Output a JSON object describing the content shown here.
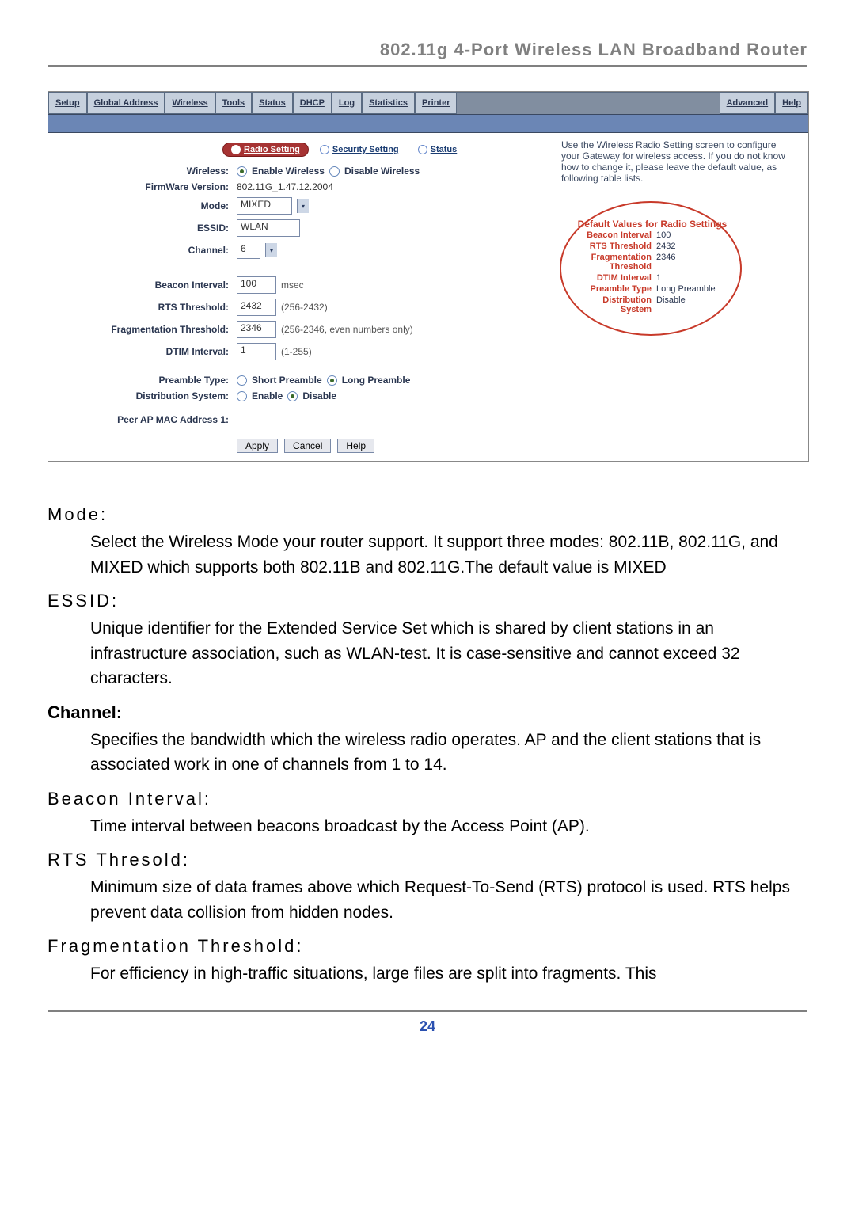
{
  "header": "802.11g 4-Port Wireless LAN Broadband Router",
  "nav": [
    "Setup",
    "Global Address",
    "Wireless",
    "Tools",
    "Status",
    "DHCP",
    "Log",
    "Statistics",
    "Printer"
  ],
  "nav_right": [
    "Advanced",
    "Help"
  ],
  "subtabs": {
    "radio": "Radio Setting",
    "security": "Security Setting",
    "status": "Status"
  },
  "form": {
    "wireless_label": "Wireless:",
    "wireless_opts": {
      "enable": "Enable Wireless",
      "disable": "Disable Wireless"
    },
    "fw_label": "FirmWare Version:",
    "fw": "802.11G_1.47.12.2004",
    "mode_label": "Mode:",
    "mode": "MIXED",
    "essid_label": "ESSID:",
    "essid": "WLAN",
    "channel_label": "Channel:",
    "channel": "6",
    "beacon_label": "Beacon Interval:",
    "beacon": "100",
    "beacon_hint": "msec",
    "rts_label": "RTS Threshold:",
    "rts": "2432",
    "rts_hint": "(256-2432)",
    "frag_label": "Fragmentation Threshold:",
    "frag": "2346",
    "frag_hint": "(256-2346, even numbers only)",
    "dtim_label": "DTIM Interval:",
    "dtim": "1",
    "dtim_hint": "(1-255)",
    "preamble_label": "Preamble Type:",
    "preamble_opts": {
      "short": "Short Preamble",
      "long": "Long Preamble"
    },
    "dist_label": "Distribution System:",
    "dist_opts": {
      "en": "Enable",
      "dis": "Disable"
    },
    "peer_label": "Peer AP MAC Address 1:",
    "btn_apply": "Apply",
    "btn_cancel": "Cancel",
    "btn_help": "Help"
  },
  "help_text": "Use the Wireless Radio Setting screen to configure your Gateway for wireless access. If you do not know how to change it, please leave the default value, as following table lists.",
  "defaults": {
    "title": "Default Values for Radio Settings",
    "rows": [
      {
        "l": "Beacon Interval",
        "v": "100"
      },
      {
        "l": "RTS Threshold",
        "v": "2432"
      },
      {
        "l": "Fragmentation Threshold",
        "v": "2346"
      },
      {
        "l": "DTIM Interval",
        "v": "1"
      },
      {
        "l": "Preamble Type",
        "v": "Long Preamble"
      },
      {
        "l": "Distribution System",
        "v": "Disable"
      }
    ]
  },
  "doc": {
    "mode_h": "Mode:",
    "mode_p": "Select the Wireless Mode your router support. It support three modes: 802.11B, 802.11G, and MIXED which supports both 802.11B and 802.11G.The default value is MIXED",
    "essid_h": "ESSID:",
    "essid_p": "Unique identifier for the Extended Service Set which is shared by client stations in an infrastructure association, such as WLAN-test. It is case-sensitive and cannot exceed 32 characters.",
    "channel_h": "Channel:",
    "channel_p": "Specifies the bandwidth which the wireless radio operates. AP and the client stations that is associated work in one of channels from 1 to 14.",
    "beacon_h": "Beacon Interval:",
    "beacon_p": "Time interval between beacons broadcast by the Access Point (AP).",
    "rts_h": "RTS Thresold:",
    "rts_p": "Minimum size of data frames above which Request-To-Send (RTS) protocol is used. RTS helps prevent data collision from hidden nodes.",
    "frag_h": "Fragmentation Threshold:",
    "frag_p": "For efficiency in high-traffic situations, large files are split into fragments. This"
  },
  "page_number": "24"
}
